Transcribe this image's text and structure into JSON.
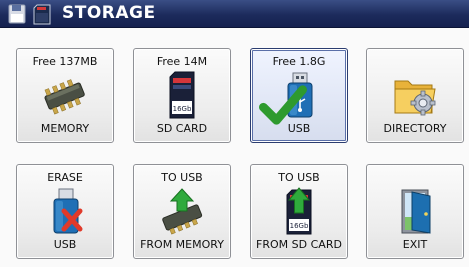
{
  "window": {
    "title": "STORAGE"
  },
  "tiles": [
    {
      "top": "Free 137MB",
      "bottom": "MEMORY",
      "icon": "memory-chip-icon"
    },
    {
      "top": "Free 14M",
      "bottom": "SD CARD",
      "icon": "sd-card-icon",
      "card_label": "16Gb"
    },
    {
      "top": "Free 1.8G",
      "bottom": "USB",
      "icon": "usb-drive-icon",
      "selected": true
    },
    {
      "top": "",
      "bottom": "DIRECTORY",
      "icon": "folder-gear-icon"
    },
    {
      "top": "ERASE",
      "bottom": "USB",
      "icon": "usb-erase-icon"
    },
    {
      "top": "TO USB",
      "bottom": "FROM MEMORY",
      "icon": "memory-to-usb-icon"
    },
    {
      "top": "TO USB",
      "bottom": "FROM SD CARD",
      "icon": "sd-to-usb-icon",
      "card_label": "16Gb"
    },
    {
      "top": "",
      "bottom": "EXIT",
      "icon": "exit-door-icon"
    }
  ],
  "colors": {
    "titlebar": "#1c2b5c",
    "selected_border": "#2b3d70",
    "check": "#2e9a2e",
    "erase_x": "#e03a2a",
    "arrow": "#2faa3c"
  }
}
